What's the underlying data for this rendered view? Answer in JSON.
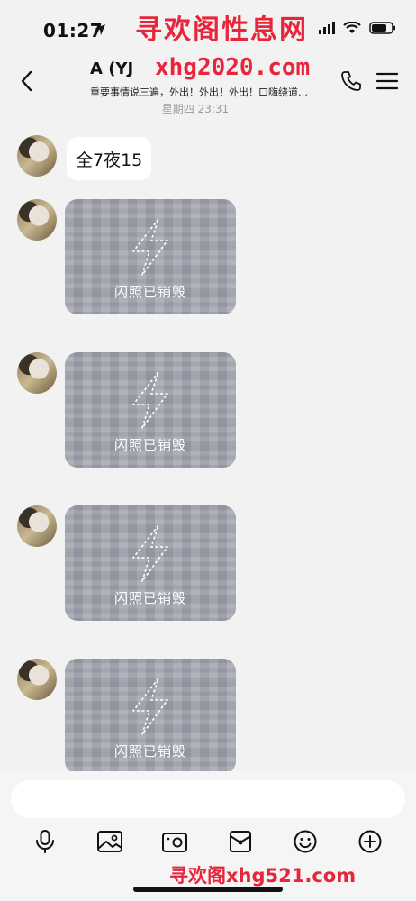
{
  "status_bar": {
    "time": "01:27"
  },
  "watermark": {
    "top": "寻欢阁性息网",
    "url": "xhg2020.com",
    "bottom": "寻欢阁xhg521.com"
  },
  "chat": {
    "title": "A  (YJ  ",
    "subtitle": "重要事情说三遍，外出！外出！外出！口嗨绕道…",
    "date_stamp": "星期四 23:31"
  },
  "messages": [
    {
      "type": "text",
      "text": "全7夜15"
    },
    {
      "type": "flash_photo",
      "label": "闪照已销毁"
    },
    {
      "type": "flash_photo",
      "label": "闪照已销毁"
    },
    {
      "type": "flash_photo",
      "label": "闪照已销毁"
    },
    {
      "type": "flash_photo",
      "label": "闪照已销毁"
    }
  ],
  "input": {
    "placeholder": "",
    "value": ""
  },
  "toolbar": {
    "items": [
      "microphone-icon",
      "image-icon",
      "camera-icon",
      "red-packet-icon",
      "emoji-icon",
      "plus-icon"
    ]
  },
  "colors": {
    "watermark": "#e8253b",
    "background": "#f2f2f2",
    "flash_photo": "#a3a6b0"
  }
}
